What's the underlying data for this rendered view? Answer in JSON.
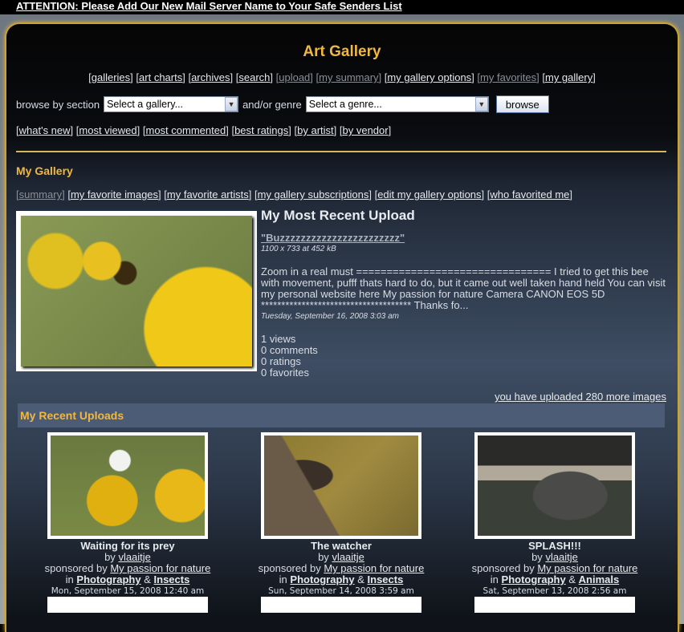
{
  "attention": "ATTENTION: Please Add Our New Mail Server Name to Your Safe Senders List",
  "title": "Art Gallery",
  "nav": [
    {
      "label": "galleries",
      "dim": false
    },
    {
      "label": "art charts",
      "dim": false
    },
    {
      "label": "archives",
      "dim": false
    },
    {
      "label": "search",
      "dim": false
    },
    {
      "label": "upload",
      "dim": true
    },
    {
      "label": "my summary",
      "dim": true
    },
    {
      "label": "my gallery options",
      "dim": false
    },
    {
      "label": "my favorites",
      "dim": true
    },
    {
      "label": "my gallery",
      "dim": false
    }
  ],
  "browse": {
    "label": "browse by section",
    "section": "Select a gallery...",
    "genre_label": "and/or genre",
    "genre": "Select a genre...",
    "button": "browse"
  },
  "links": [
    "what's new",
    "most viewed",
    "most commented",
    "best ratings",
    "by artist",
    "by vendor"
  ],
  "my_gallery": {
    "heading": "My Gallery",
    "sub": [
      "summary",
      "my favorite images",
      "my favorite artists",
      "my gallery subscriptions",
      "edit my gallery options",
      "who favorited me"
    ]
  },
  "recent": {
    "heading": "My Most Recent Upload",
    "title": "\"Buzzzzzzzzzzzzzzzzzzzzzzz\"",
    "dims": "1100 x 733 at 452 kB",
    "desc": "Zoom in a real must ================================ I tried to get this bee with movement, pufff thats hard to do, but it came out well taken hand held You can visit my personal website here My passion for nature Camera CANON EOS 5D ************************************* Thanks fo...",
    "date": "Tuesday, September 16, 2008 3:03 am",
    "views": "1 views",
    "comments": "0 comments",
    "ratings": "0 ratings",
    "favorites": "0 favorites"
  },
  "more": "you have uploaded 280 more images",
  "uploads_heading": "My Recent Uploads",
  "uploads": [
    {
      "title": "Waiting for its prey",
      "by": "by",
      "artist": "vlaaitje",
      "sp": "sponsored by",
      "sponsor": "My passion for nature",
      "in": "in",
      "cat": "Photography",
      "amp": "&",
      "genre": "Insects",
      "date": "Mon, September 15, 2008 12:40 am"
    },
    {
      "title": "The watcher",
      "by": "by",
      "artist": "vlaaitje",
      "sp": "sponsored by",
      "sponsor": "My passion for nature",
      "in": "in",
      "cat": "Photography",
      "amp": "&",
      "genre": "Insects",
      "date": "Sun, September 14, 2008 3:59 am"
    },
    {
      "title": "SPLASH!!!",
      "by": "by",
      "artist": "vlaaitje",
      "sp": "sponsored by",
      "sponsor": "My passion for nature",
      "in": "in",
      "cat": "Photography",
      "amp": "&",
      "genre": "Animals",
      "date": "Sat, September 13, 2008 2:56 am"
    }
  ]
}
